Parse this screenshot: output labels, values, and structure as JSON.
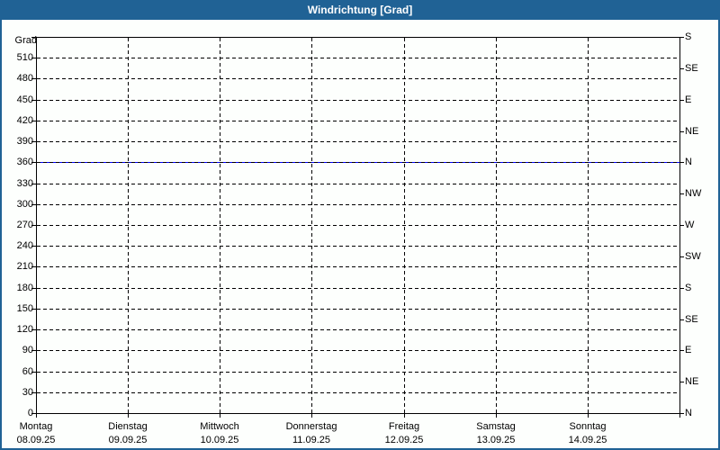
{
  "window": {
    "title": "Windrichtung [Grad]"
  },
  "colors": {
    "titlebar_bg": "#206295",
    "titlebar_text": "#ffffff",
    "frame_border": "#206295",
    "chart_bg": "#fdfffd",
    "axis": "#000000",
    "grid": "#000000",
    "series_line": "#0000ff",
    "label_text": "#000000"
  },
  "chart_data": {
    "type": "line",
    "title": "Windrichtung [Grad]",
    "y_axis": {
      "label": "Grad",
      "min": 0,
      "max": 540,
      "tick_step": 30,
      "tick_labels": [
        "0",
        "30",
        "60",
        "90",
        "120",
        "150",
        "180",
        "210",
        "240",
        "270",
        "300",
        "330",
        "360",
        "390",
        "420",
        "450",
        "480",
        "510"
      ]
    },
    "y2_axis": {
      "description": "compass directions every 45 degrees, bottom to top",
      "tick_step": 45,
      "tick_labels_bottom_to_top": [
        "N",
        "NE",
        "E",
        "SE",
        "S",
        "SW",
        "W",
        "NW",
        "N",
        "NE",
        "E",
        "SE",
        "S"
      ]
    },
    "x_axis": {
      "days": [
        {
          "name": "Montag",
          "date": "08.09.25"
        },
        {
          "name": "Dienstag",
          "date": "09.09.25"
        },
        {
          "name": "Mittwoch",
          "date": "10.09.25"
        },
        {
          "name": "Donnerstag",
          "date": "11.09.25"
        },
        {
          "name": "Freitag",
          "date": "12.09.25"
        },
        {
          "name": "Samstag",
          "date": "13.09.25"
        },
        {
          "name": "Sonntag",
          "date": "14.09.25"
        }
      ]
    },
    "grid": {
      "horizontal_step": 30,
      "vertical": "day boundaries",
      "style": "dashed"
    },
    "series": [
      {
        "name": "Windrichtung",
        "color": "#0000ff",
        "style": "solid",
        "values": "constant over entire week",
        "constant_value_deg": 360,
        "compass": "N"
      }
    ]
  }
}
